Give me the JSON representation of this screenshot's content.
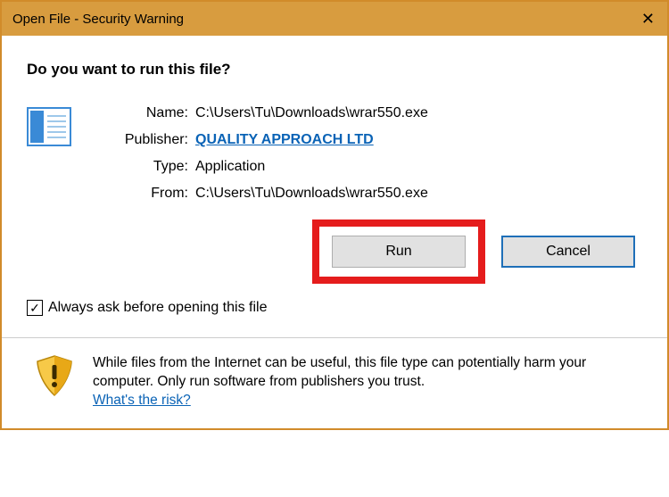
{
  "titlebar": {
    "title": "Open File - Security Warning",
    "close_glyph": "✕"
  },
  "question": "Do you want to run this file?",
  "details": {
    "name_label": "Name:",
    "name_value": "C:\\Users\\Tu\\Downloads\\wrar550.exe",
    "publisher_label": "Publisher:",
    "publisher_value": "QUALITY APPROACH LTD",
    "type_label": "Type:",
    "type_value": "Application",
    "from_label": "From:",
    "from_value": "C:\\Users\\Tu\\Downloads\\wrar550.exe"
  },
  "buttons": {
    "run": "Run",
    "cancel": "Cancel"
  },
  "checkbox": {
    "checked_glyph": "✓",
    "label": "Always ask before opening this file"
  },
  "footer": {
    "warning_text": "While files from the Internet can be useful, this file type can potentially harm your computer. Only run software from publishers you trust.",
    "risk_link": "What's the risk?"
  },
  "icons": {
    "file": "file-icon",
    "shield": "shield-icon"
  }
}
